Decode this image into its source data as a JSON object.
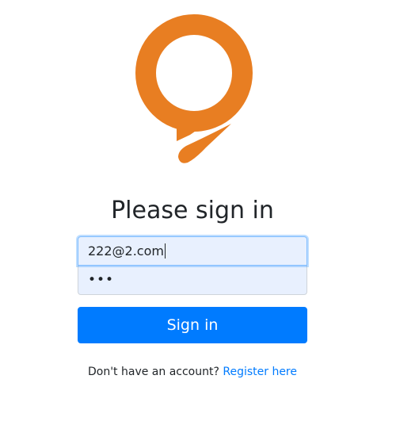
{
  "brand": {
    "logo_icon": "orange-chat-bubble-logo",
    "logo_color": "#e87e22"
  },
  "heading": "Please sign in",
  "form": {
    "email_value": "222@2.com",
    "password_masked": "•••"
  },
  "submit": {
    "label": "Sign in",
    "color": "#007bff"
  },
  "register": {
    "prompt": "Don't have an account?",
    "link_label": "Register here",
    "link_color": "#007bff"
  }
}
